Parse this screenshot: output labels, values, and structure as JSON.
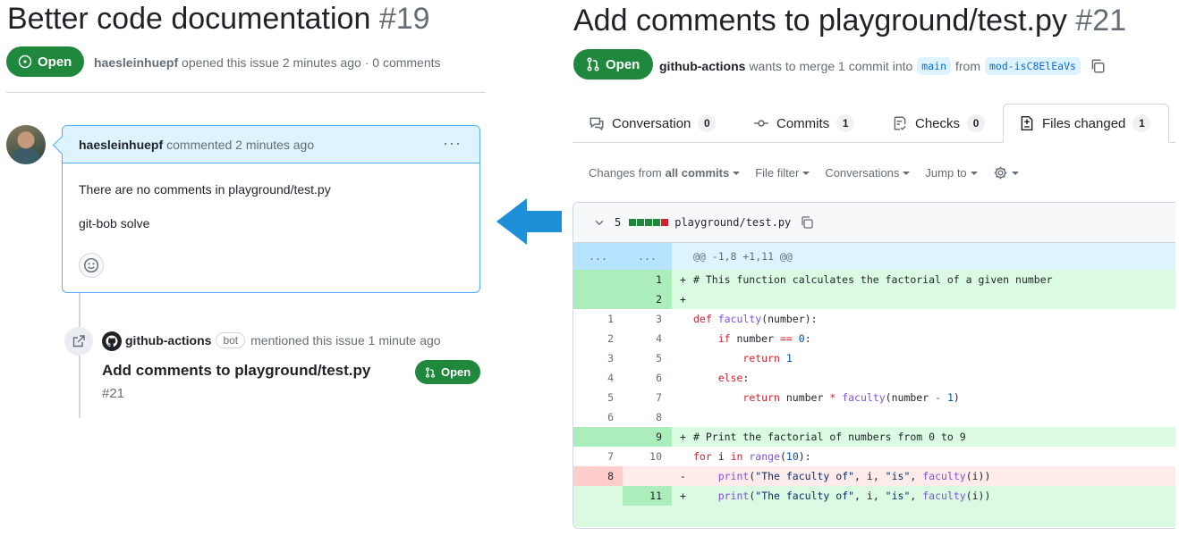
{
  "issue": {
    "title": "Better code documentation",
    "number": "#19",
    "state": "Open",
    "author": "haesleinhuepf",
    "meta_text": "opened this issue 2 minutes ago · 0 comments",
    "comment": {
      "author": "haesleinhuepf",
      "time": "commented 2 minutes ago",
      "lines": [
        "There are no comments in playground/test.py",
        "git-bob solve"
      ]
    },
    "xref": {
      "actor": "github-actions",
      "badge": "bot",
      "text": "mentioned this issue 1 minute ago",
      "title": "Add comments to playground/test.py",
      "number": "#21",
      "state": "Open"
    }
  },
  "pr": {
    "title": "Add comments to playground/test.py",
    "number": "#21",
    "state": "Open",
    "actor": "github-actions",
    "meta_mid": "wants to merge 1 commit into",
    "base_branch": "main",
    "meta_from": "from",
    "head_branch": "mod-isC8ElEaVs",
    "tabs": [
      {
        "label": "Conversation",
        "count": "0",
        "icon": "comment-icon"
      },
      {
        "label": "Commits",
        "count": "1",
        "icon": "commit-icon"
      },
      {
        "label": "Checks",
        "count": "0",
        "icon": "checklist-icon"
      },
      {
        "label": "Files changed",
        "count": "1",
        "icon": "diff-icon"
      }
    ],
    "toolbar": {
      "changes_from": "Changes from",
      "all_commits": "all commits",
      "file_filter": "File filter",
      "conversations": "Conversations",
      "jump_to": "Jump to"
    },
    "file": {
      "changes": "5",
      "path": "playground/test.py",
      "hunk": "@@ -1,8 +1,11 @@",
      "expand_left": "...",
      "expand_right": "..."
    }
  },
  "colors": {
    "open_green": "#1f883d",
    "arrow_blue": "#1e90d8",
    "add_bg": "#dafbe1",
    "del_bg": "#ffebe9"
  }
}
